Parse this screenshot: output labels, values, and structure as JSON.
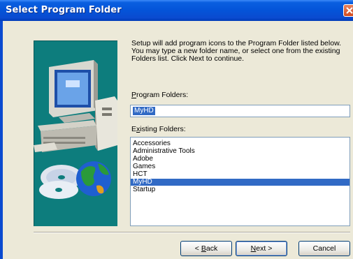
{
  "window": {
    "title": "Select Program Folder"
  },
  "intro_text": "Setup will add program icons to the Program Folder listed below.\nYou may type a new folder name, or select one from the existing\nFolders list.  Click Next to continue.",
  "program_folders": {
    "label_underlined": "P",
    "label_rest": "rogram Folders:",
    "value": "MyHD"
  },
  "existing_folders": {
    "label_start": "E",
    "label_underlined": "x",
    "label_rest": "isting Folders:",
    "items": [
      "Accessories",
      "Administrative Tools",
      "Adobe",
      "Games",
      "HCT",
      "MyHD",
      "Startup"
    ],
    "selected": "MyHD"
  },
  "buttons": {
    "back_prefix": "< ",
    "back_underlined": "B",
    "back_rest": "ack",
    "next_underlined": "N",
    "next_rest": "ext >",
    "cancel": "Cancel"
  },
  "icons": [
    "close-icon",
    "computer-icon",
    "cd-disc-icon",
    "globe-icon"
  ],
  "colors": {
    "panel": "#0d7d7d",
    "selection": "#316ac5",
    "titlebar": "#0454d8"
  }
}
